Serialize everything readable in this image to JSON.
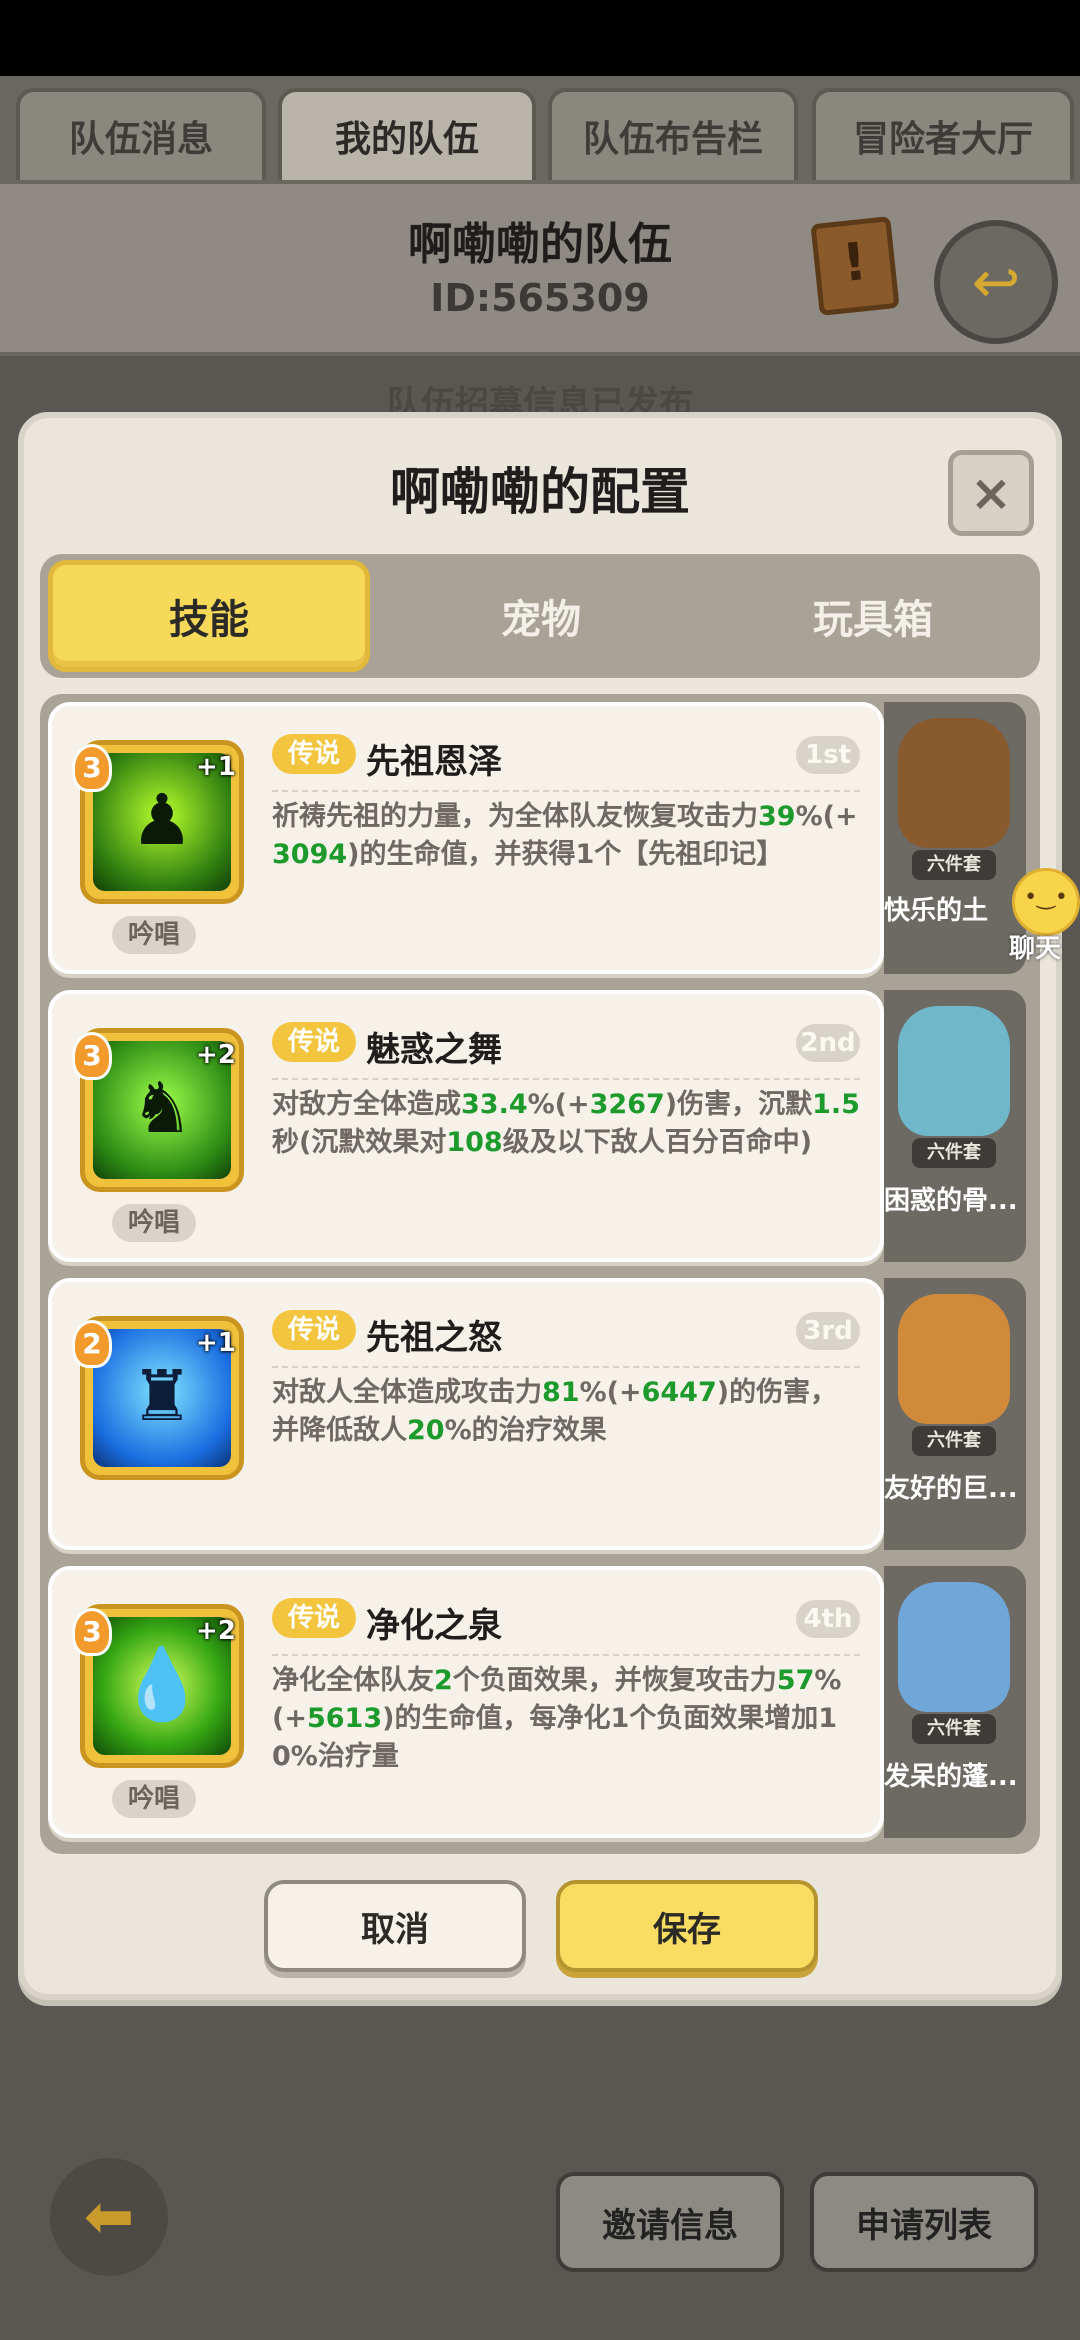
{
  "top_tabs": [
    {
      "label": "队伍消息",
      "active": false
    },
    {
      "label": "我的队伍",
      "active": true
    },
    {
      "label": "队伍布告栏",
      "active": false
    },
    {
      "label": "冒险者大厅",
      "active": false
    }
  ],
  "team": {
    "title": "啊嘞嘞的队伍",
    "id": "ID:565309",
    "notice_behind": "队伍招募信息已发布"
  },
  "modal": {
    "title": "啊嘞嘞的配置",
    "close_label": "×",
    "tabs": [
      {
        "label": "技能",
        "active": true
      },
      {
        "label": "宠物",
        "active": false
      },
      {
        "label": "玩具箱",
        "active": false
      }
    ],
    "skills": [
      {
        "tag": "传说",
        "name": "先祖恩泽",
        "rank": "1st",
        "level": "3",
        "plus": "+1",
        "chant": "吟唱",
        "icon": "ancestor-blessing-icon",
        "desc_parts": [
          "祈祷先祖的力量，为全体队友恢复攻击力",
          "39",
          "%(+",
          "3094",
          ")的生命值，并获得1个【先祖印记】"
        ]
      },
      {
        "tag": "传说",
        "name": "魅惑之舞",
        "rank": "2nd",
        "level": "3",
        "plus": "+2",
        "chant": "吟唱",
        "icon": "charm-dance-icon",
        "desc_parts": [
          "对敌方全体造成",
          "33.4",
          "%(+",
          "3267",
          ")伤害，沉默",
          "1.5",
          "秒(沉默效果对",
          "108",
          "级及以下敌人百分百命中)"
        ]
      },
      {
        "tag": "传说",
        "name": "先祖之怒",
        "rank": "3rd",
        "level": "2",
        "plus": "+1",
        "chant": "",
        "icon": "ancestor-wrath-icon",
        "desc_parts": [
          "对敌人全体造成攻击力",
          "81",
          "%(+",
          "6447",
          ")的伤害，并降低敌人",
          "20",
          "%的治疗效果"
        ]
      },
      {
        "tag": "传说",
        "name": "净化之泉",
        "rank": "4th",
        "level": "3",
        "plus": "+2",
        "chant": "吟唱",
        "icon": "purify-spring-icon",
        "desc_parts": [
          "净化全体队友",
          "2",
          "个负面效果，并恢复攻击力",
          "57",
          "%(+",
          "5613",
          ")的生命值，每净化1个负面效果增加10%治疗量"
        ]
      }
    ],
    "pets": [
      {
        "name": "快乐的土",
        "tag": "六件套",
        "color": "#8a5a2f"
      },
      {
        "name": "困惑的骨...",
        "tag": "六件套",
        "color": "#6fb7c9"
      },
      {
        "name": "友好的巨...",
        "tag": "六件套",
        "color": "#d08a3a"
      },
      {
        "name": "发呆的蓬...",
        "tag": "六件套",
        "color": "#6fa7d8"
      }
    ],
    "cancel_label": "取消",
    "save_label": "保存"
  },
  "chat": {
    "label": "聊天"
  },
  "bottom": {
    "invite_label": "邀请信息",
    "apply_label": "申请列表"
  },
  "colors": {
    "accent_yellow": "#f7d95a",
    "highlight_green": "#1d9a2c",
    "legend_tag": "#f3c43d"
  }
}
